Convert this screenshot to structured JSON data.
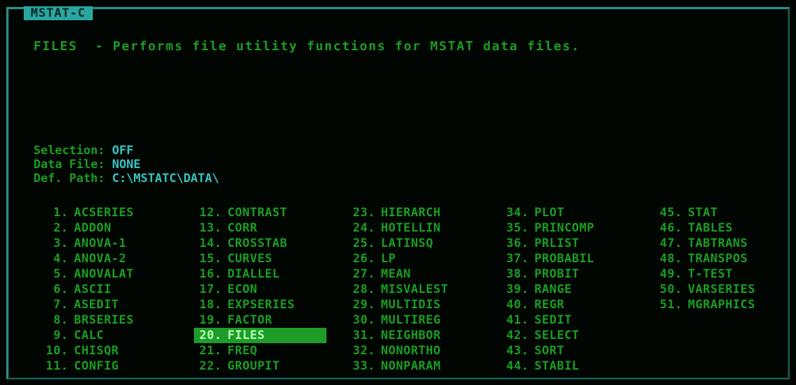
{
  "window": {
    "title": "MSTAT-C"
  },
  "header": {
    "program": "FILES",
    "description": "  - Performs file utility functions for MSTAT data files."
  },
  "status": {
    "selection_label": "Selection: ",
    "selection_value": "OFF",
    "datafile_label": "Data File: ",
    "datafile_value": "NONE",
    "path_label": "Def. Path: ",
    "path_value": "C:\\MSTATC\\DATA\\"
  },
  "menu": {
    "selected_item": "FILES",
    "columns": [
      [
        {
          "num": "1.",
          "name": "ACSERIES"
        },
        {
          "num": "2.",
          "name": "ADDON"
        },
        {
          "num": "3.",
          "name": "ANOVA-1"
        },
        {
          "num": "4.",
          "name": "ANOVA-2"
        },
        {
          "num": "5.",
          "name": "ANOVALAT"
        },
        {
          "num": "6.",
          "name": "ASCII"
        },
        {
          "num": "7.",
          "name": "ASEDIT"
        },
        {
          "num": "8.",
          "name": "BRSERIES"
        },
        {
          "num": "9.",
          "name": "CALC"
        },
        {
          "num": "10.",
          "name": "CHISQR"
        },
        {
          "num": "11.",
          "name": "CONFIG"
        }
      ],
      [
        {
          "num": "12.",
          "name": "CONTRAST"
        },
        {
          "num": "13.",
          "name": "CORR"
        },
        {
          "num": "14.",
          "name": "CROSSTAB"
        },
        {
          "num": "15.",
          "name": "CURVES"
        },
        {
          "num": "16.",
          "name": "DIALLEL"
        },
        {
          "num": "17.",
          "name": "ECON"
        },
        {
          "num": "18.",
          "name": "EXPSERIES"
        },
        {
          "num": "19.",
          "name": "FACTOR"
        },
        {
          "num": "20.",
          "name": "FILES"
        },
        {
          "num": "21.",
          "name": "FREQ"
        },
        {
          "num": "22.",
          "name": "GROUPIT"
        }
      ],
      [
        {
          "num": "23.",
          "name": "HIERARCH"
        },
        {
          "num": "24.",
          "name": "HOTELLIN"
        },
        {
          "num": "25.",
          "name": "LATINSQ"
        },
        {
          "num": "26.",
          "name": "LP"
        },
        {
          "num": "27.",
          "name": "MEAN"
        },
        {
          "num": "28.",
          "name": "MISVALEST"
        },
        {
          "num": "29.",
          "name": "MULTIDIS"
        },
        {
          "num": "30.",
          "name": "MULTIREG"
        },
        {
          "num": "31.",
          "name": "NEIGHBOR"
        },
        {
          "num": "32.",
          "name": "NONORTHO"
        },
        {
          "num": "33.",
          "name": "NONPARAM"
        }
      ],
      [
        {
          "num": "34.",
          "name": "PLOT"
        },
        {
          "num": "35.",
          "name": "PRINCOMP"
        },
        {
          "num": "36.",
          "name": "PRLIST"
        },
        {
          "num": "37.",
          "name": "PROBABIL"
        },
        {
          "num": "38.",
          "name": "PROBIT"
        },
        {
          "num": "39.",
          "name": "RANGE"
        },
        {
          "num": "40.",
          "name": "REGR"
        },
        {
          "num": "41.",
          "name": "SEDIT"
        },
        {
          "num": "42.",
          "name": "SELECT"
        },
        {
          "num": "43.",
          "name": "SORT"
        },
        {
          "num": "44.",
          "name": "STABIL"
        }
      ],
      [
        {
          "num": "45.",
          "name": "STAT"
        },
        {
          "num": "46.",
          "name": "TABLES"
        },
        {
          "num": "47.",
          "name": "TABTRANS"
        },
        {
          "num": "48.",
          "name": "TRANSPOS"
        },
        {
          "num": "49.",
          "name": "T-TEST"
        },
        {
          "num": "50.",
          "name": "VARSERIES"
        },
        {
          "num": "51.",
          "name": "MGRAPHICS"
        }
      ]
    ]
  },
  "colors": {
    "text_green": "#1a9d23",
    "value_cyan": "#36c4c0",
    "frame_teal": "#2f8f86",
    "highlight_bg": "#1d9c2a"
  }
}
